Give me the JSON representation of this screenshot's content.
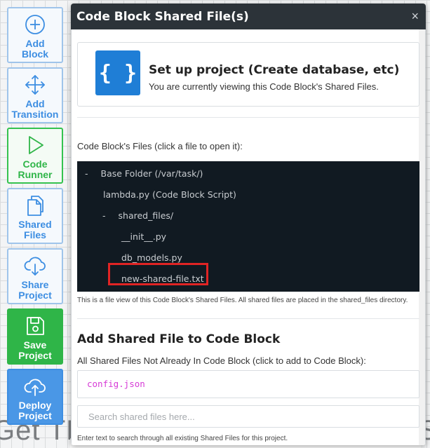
{
  "background": {
    "left_text": "Get TLD",
    "right_text": "S"
  },
  "sidebar": {
    "items": [
      {
        "line1": "Add",
        "line2": "Block",
        "icon": "plus-circle-icon"
      },
      {
        "line1": "Add",
        "line2": "Transition",
        "icon": "move-arrows-icon"
      },
      {
        "line1": "Code",
        "line2": "Runner",
        "icon": "play-icon"
      },
      {
        "line1": "Shared",
        "line2": "Files",
        "icon": "files-icon"
      },
      {
        "line1": "Share",
        "line2": "Project",
        "icon": "cloud-download-icon"
      },
      {
        "line1": "Save",
        "line2": "Project",
        "icon": "floppy-disk-icon"
      },
      {
        "line1": "Deploy",
        "line2": "Project",
        "icon": "cloud-upload-icon"
      }
    ]
  },
  "modal": {
    "title": "Code Block Shared File(s)",
    "close": "×",
    "card": {
      "icon_text": "{ }",
      "title": "Set up project (Create database, etc)",
      "subtitle": "You are currently viewing this Code Block's Shared Files."
    },
    "files_label": "Code Block's Files (click a file to open it):",
    "tree": [
      {
        "prefix": "-",
        "text": "Base Folder (/var/task/)"
      },
      {
        "prefix": "",
        "text": "lambda.py (Code Block Script)"
      },
      {
        "prefix": "-",
        "text": "shared_files/"
      },
      {
        "prefix": "",
        "text": "__init__.py"
      },
      {
        "prefix": "",
        "text": "db_models.py"
      },
      {
        "prefix": "",
        "text": "new-shared-file.txt"
      }
    ],
    "tree_note": "This is a file view of this Code Block's Shared Files. All shared files are placed in the shared_files directory.",
    "add_section": {
      "title": "Add Shared File to Code Block",
      "subtitle": "All Shared Files Not Already In Code Block (click to add to Code Block):",
      "files": [
        "config.json"
      ],
      "search_placeholder": "Search shared files here...",
      "search_help": "Enter text to search through all existing Shared Files for this project."
    }
  },
  "colors": {
    "header_bg": "#2c3339",
    "tree_bg": "#111a22",
    "accent_blue": "#1f7ed6",
    "accent_green": "#2fb548",
    "highlight_red": "#e02424",
    "file_chip": "#d63ad6"
  }
}
